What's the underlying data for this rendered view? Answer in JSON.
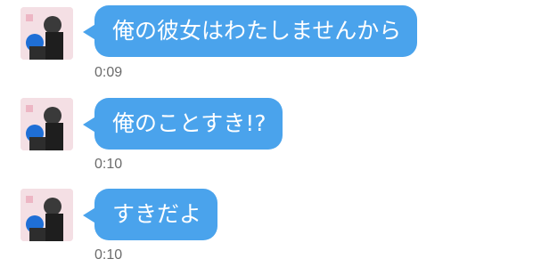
{
  "messages": [
    {
      "text": "俺の彼女はわたしませんから",
      "time": "0:09"
    },
    {
      "text": "俺のことすき!?",
      "time": "0:10"
    },
    {
      "text": "すきだよ",
      "time": "0:10"
    }
  ],
  "colors": {
    "bubble": "#4aa3ec",
    "bubble_text": "#ffffff",
    "timestamp": "#6b6b6b",
    "background": "#ffffff"
  },
  "icons": {
    "avatar": "avatar-photo"
  }
}
